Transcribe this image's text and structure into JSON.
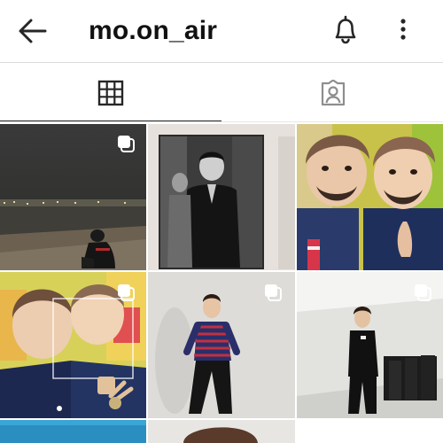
{
  "header": {
    "back_icon": "arrow-left-icon",
    "title": "mo.on_air",
    "bell_icon": "bell-icon",
    "more_icon": "more-vertical-icon"
  },
  "tabs": [
    {
      "name": "posts",
      "icon": "grid-icon",
      "active": true
    },
    {
      "name": "tagged",
      "icon": "tagged-person-icon",
      "active": false
    }
  ],
  "grid": {
    "posts": [
      {
        "subject": "night-river-photo",
        "multiple": true
      },
      {
        "subject": "black-and-white-photo",
        "multiple": false
      },
      {
        "subject": "face-filter-photo",
        "multiple": false
      },
      {
        "subject": "classroom-selfie-photo",
        "multiple": true
      },
      {
        "subject": "striped-sweater-photo",
        "multiple": true
      },
      {
        "subject": "hallway-photo",
        "multiple": true
      },
      {
        "subject": "blue-photo",
        "multiple": false
      },
      {
        "subject": "portrait-photo",
        "multiple": false
      }
    ]
  },
  "colors": {
    "icon": "#262626",
    "divider": "#dbdbdb",
    "indicator": "#262626",
    "background": "#ffffff"
  }
}
